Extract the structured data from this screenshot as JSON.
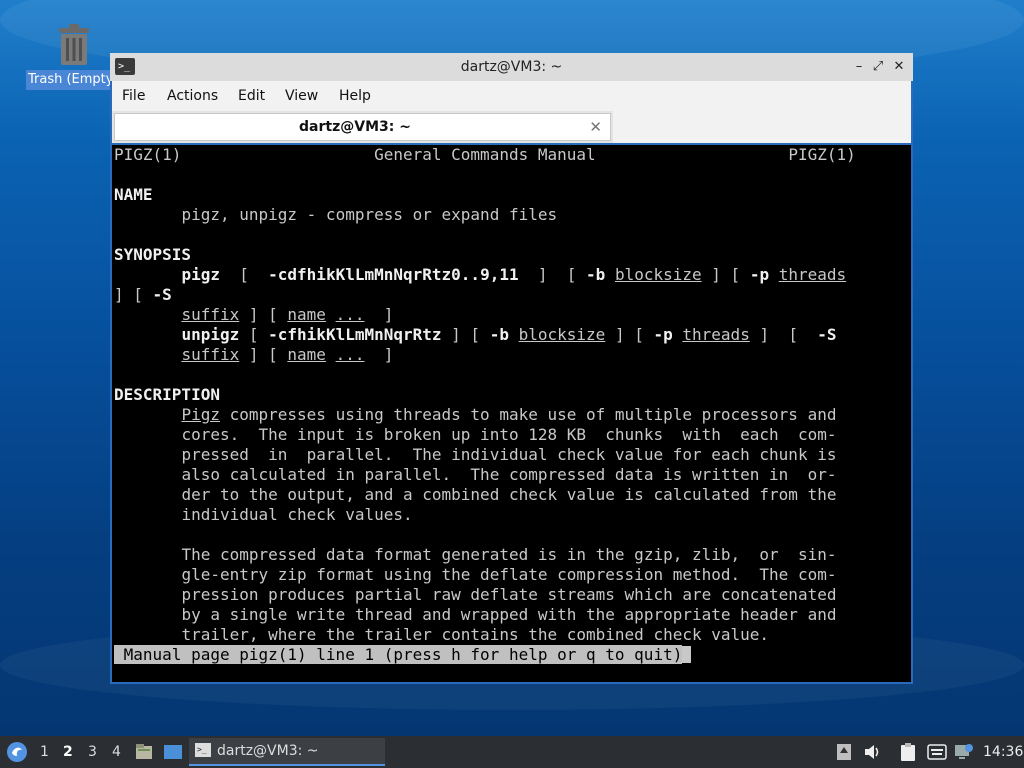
{
  "desktop": {
    "trash_label": "Trash (Empty)"
  },
  "window": {
    "title": "dartz@VM3: ~",
    "minimize": "–",
    "maximize": "⤢",
    "close": "✕",
    "menu": [
      "File",
      "Actions",
      "Edit",
      "View",
      "Help"
    ],
    "tab_label": "dartz@VM3: ~",
    "tab_close": "✕"
  },
  "terminal": {
    "header_left": "PIGZ(1)",
    "header_center": "General Commands Manual",
    "header_right": "PIGZ(1)",
    "name_heading": "NAME",
    "name_text": "pigz, unpigz - compress or expand files",
    "synopsis_heading": "SYNOPSIS",
    "pigz_cmd": "pigz",
    "pigz_opts": "-cdfhikKlLmMnNqrRtz0..9,11",
    "opt_b": "-b",
    "blocksize": "blocksize",
    "opt_p": "-p",
    "threads": "threads",
    "opt_S": "-S",
    "suffix": "suffix",
    "name_arg": "name",
    "ellipsis": "...",
    "unpigz_cmd": "unpigz",
    "unpigz_opts": "-cfhikKlLmMnNqrRtz",
    "description_heading": "DESCRIPTION",
    "pigz_word": "Pigz",
    "desc_lines": [
      " compresses using threads to make use of multiple processors and",
      "cores.  The input is broken up into 128 KB  chunks  with  each  com-",
      "pressed  in  parallel.  The individual check value for each chunk is",
      "also calculated in parallel.  The compressed data is written in  or-",
      "der to the output, and a combined check value is calculated from the",
      "individual check values.",
      "",
      "The compressed data format generated is in the gzip, zlib,  or  sin-",
      "gle-entry zip format using the deflate compression method.  The com-",
      "pression produces partial raw deflate streams which are concatenated",
      "by a single write thread and wrapped with the appropriate header and",
      "trailer, where the trailer contains the combined check value."
    ],
    "status_line": " Manual page pigz(1) line 1 (press h for help or q to quit)"
  },
  "taskbar": {
    "workspaces": [
      "1",
      "2",
      "3",
      "4"
    ],
    "active_workspace": "2",
    "task_label": "dartz@VM3: ~",
    "clock": "14:36"
  },
  "colors": {
    "taskbar": "#2b2f33",
    "accent": "#5294e2",
    "window_border": "#2a6bbd"
  }
}
